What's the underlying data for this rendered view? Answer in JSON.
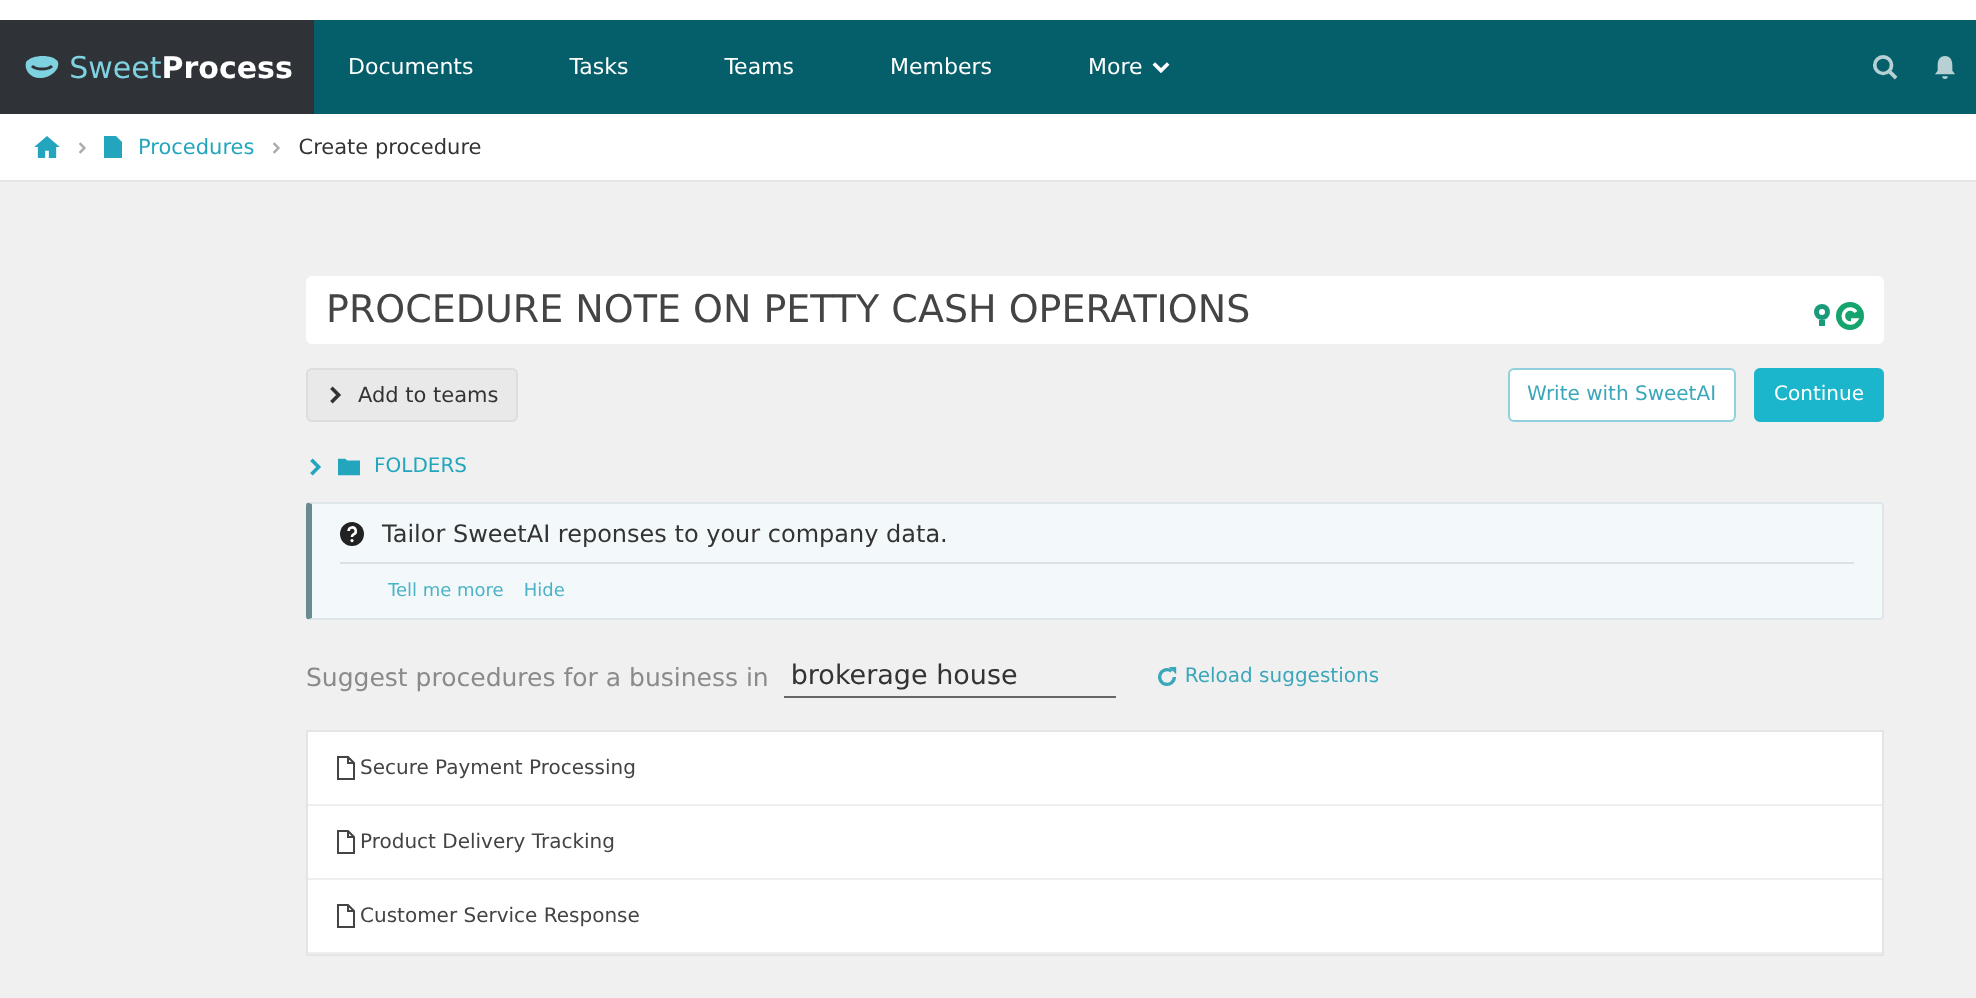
{
  "logo": {
    "part_1": "Sweet",
    "part_2": "Process"
  },
  "nav": {
    "items": [
      {
        "label": "Documents"
      },
      {
        "label": "Tasks"
      },
      {
        "label": "Teams"
      },
      {
        "label": "Members"
      },
      {
        "label": "More",
        "dropdown": true
      }
    ]
  },
  "breadcrumb": [
    {
      "label": "Procedures",
      "kind": "link"
    },
    {
      "label": "Create procedure",
      "kind": "current"
    }
  ],
  "title_field": {
    "value": "PROCEDURE NOTE ON PETTY CASH OPERATIONS"
  },
  "add_to_teams": {
    "label": "Add to teams",
    "expanded": false
  },
  "buttons": [
    {
      "label": "Write with SweetAI",
      "kind": "outline"
    },
    {
      "label": "Continue",
      "kind": "primary"
    }
  ],
  "folders": {
    "label": "FOLDERS",
    "expanded": false
  },
  "info": {
    "text": "Tailor SweetAI reponses to your company data.",
    "links": [
      "Tell me more",
      "Hide"
    ]
  },
  "suggest": {
    "label": "Suggest procedures for a business in",
    "value": "brokerage house",
    "reload": "Reload suggestions"
  },
  "suggestions": [
    {
      "title": "Secure Payment Processing"
    },
    {
      "title": "Product Delivery Tracking"
    },
    {
      "title": "Customer Service Response"
    }
  ]
}
